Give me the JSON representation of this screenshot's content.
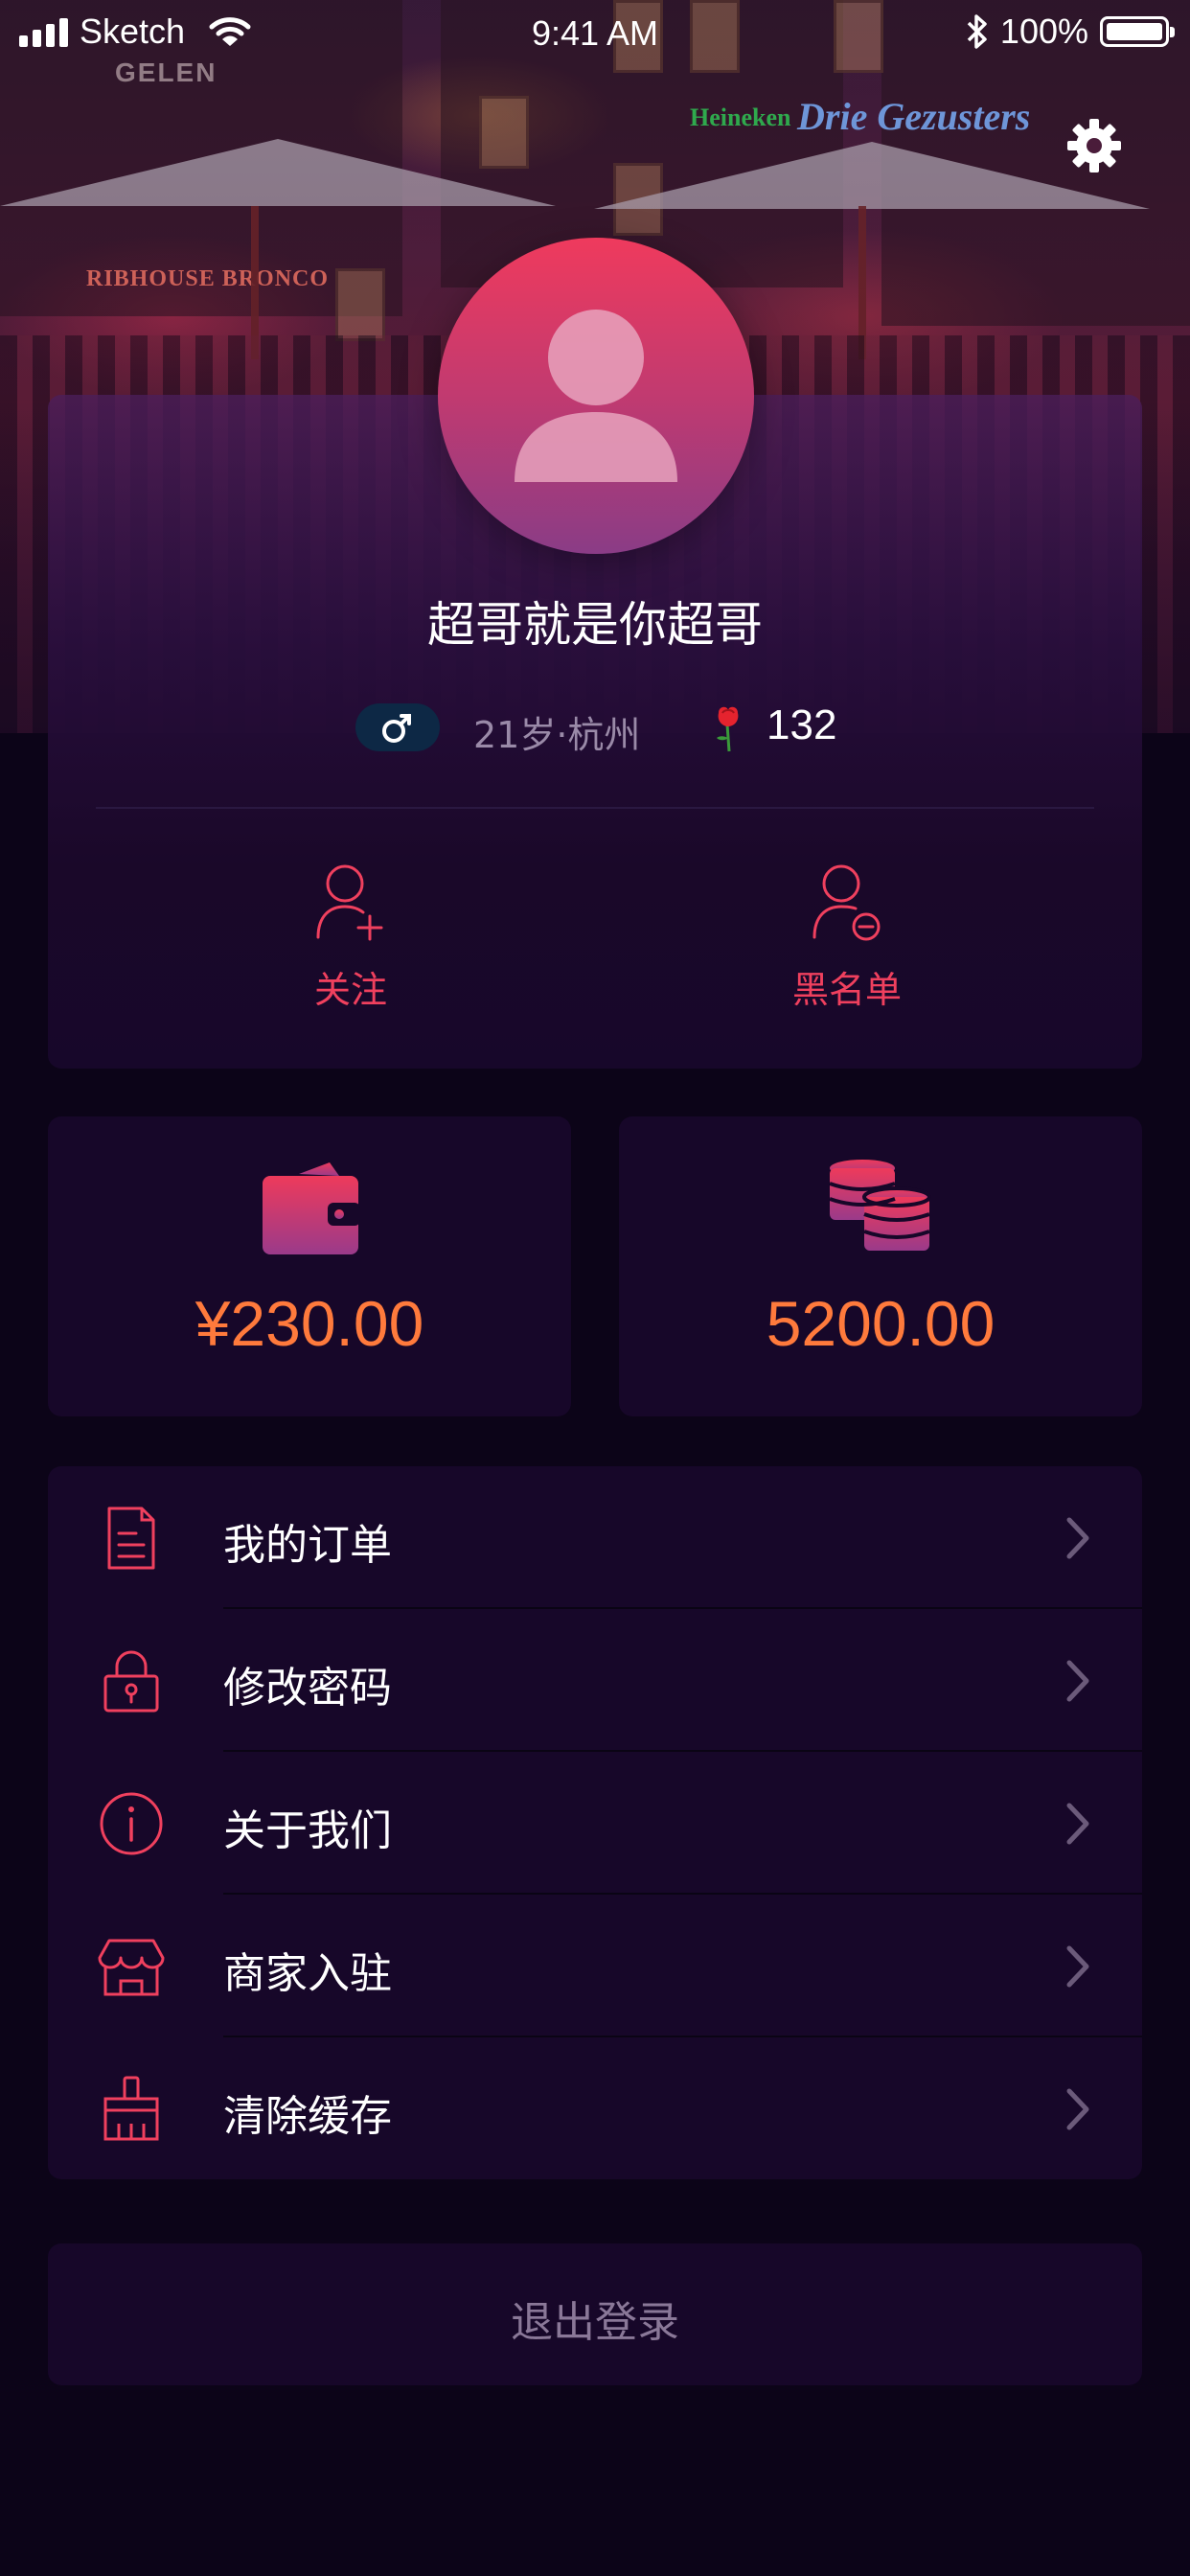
{
  "status_bar": {
    "carrier": "Sketch",
    "time": "9:41 AM",
    "battery": "100%"
  },
  "profile": {
    "name": "超哥就是你超哥",
    "gender_symbol": "♂",
    "age_city": "21岁·杭州",
    "roses": "132"
  },
  "actions": {
    "follow": "关注",
    "blacklist": "黑名单"
  },
  "balances": {
    "wallet": "¥230.00",
    "coins": "5200.00"
  },
  "menu": {
    "items": [
      {
        "label": "我的订单",
        "icon": "document-icon"
      },
      {
        "label": "修改密码",
        "icon": "lock-icon"
      },
      {
        "label": "关于我们",
        "icon": "info-icon"
      },
      {
        "label": "商家入驻",
        "icon": "store-icon"
      },
      {
        "label": "清除缓存",
        "icon": "broom-icon"
      }
    ]
  },
  "logout_label": "退出登录",
  "colors": {
    "accent": "#f0405e",
    "amount": "#ff7a3c",
    "card": "#170729",
    "background": "#0c0418"
  }
}
